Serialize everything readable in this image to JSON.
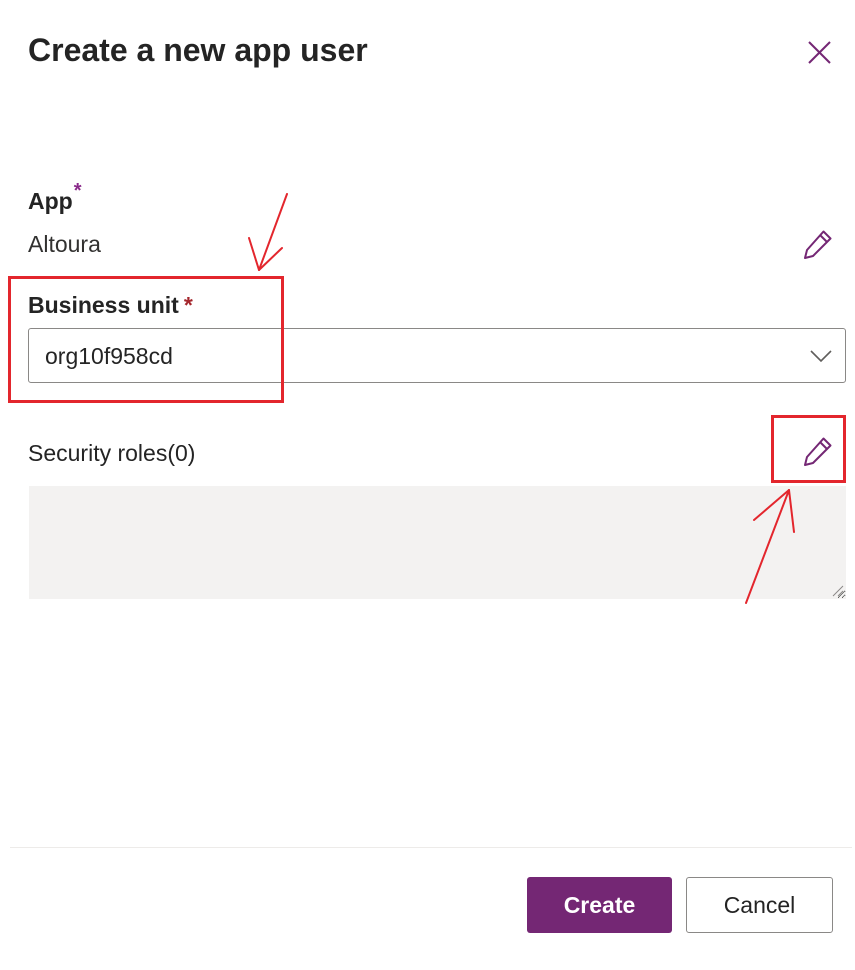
{
  "panel": {
    "title": "Create a new app user",
    "close_icon": "close-icon"
  },
  "app_field": {
    "label": "App",
    "required_mark": "*",
    "value": "Altoura",
    "edit_icon": "pencil-icon"
  },
  "business_unit": {
    "label": "Business unit",
    "required_mark": "*",
    "selected": "org10f958cd",
    "chevron_icon": "chevron-down-icon"
  },
  "security_roles": {
    "label": "Security roles(0)",
    "edit_icon": "pencil-icon",
    "value": ""
  },
  "footer": {
    "create_label": "Create",
    "cancel_label": "Cancel"
  },
  "colors": {
    "accent": "#742774",
    "required_app": "#8a2a8a",
    "required_bu": "#a4262c",
    "annotation": "#e3262d",
    "roles_background": "#f3f2f1"
  }
}
